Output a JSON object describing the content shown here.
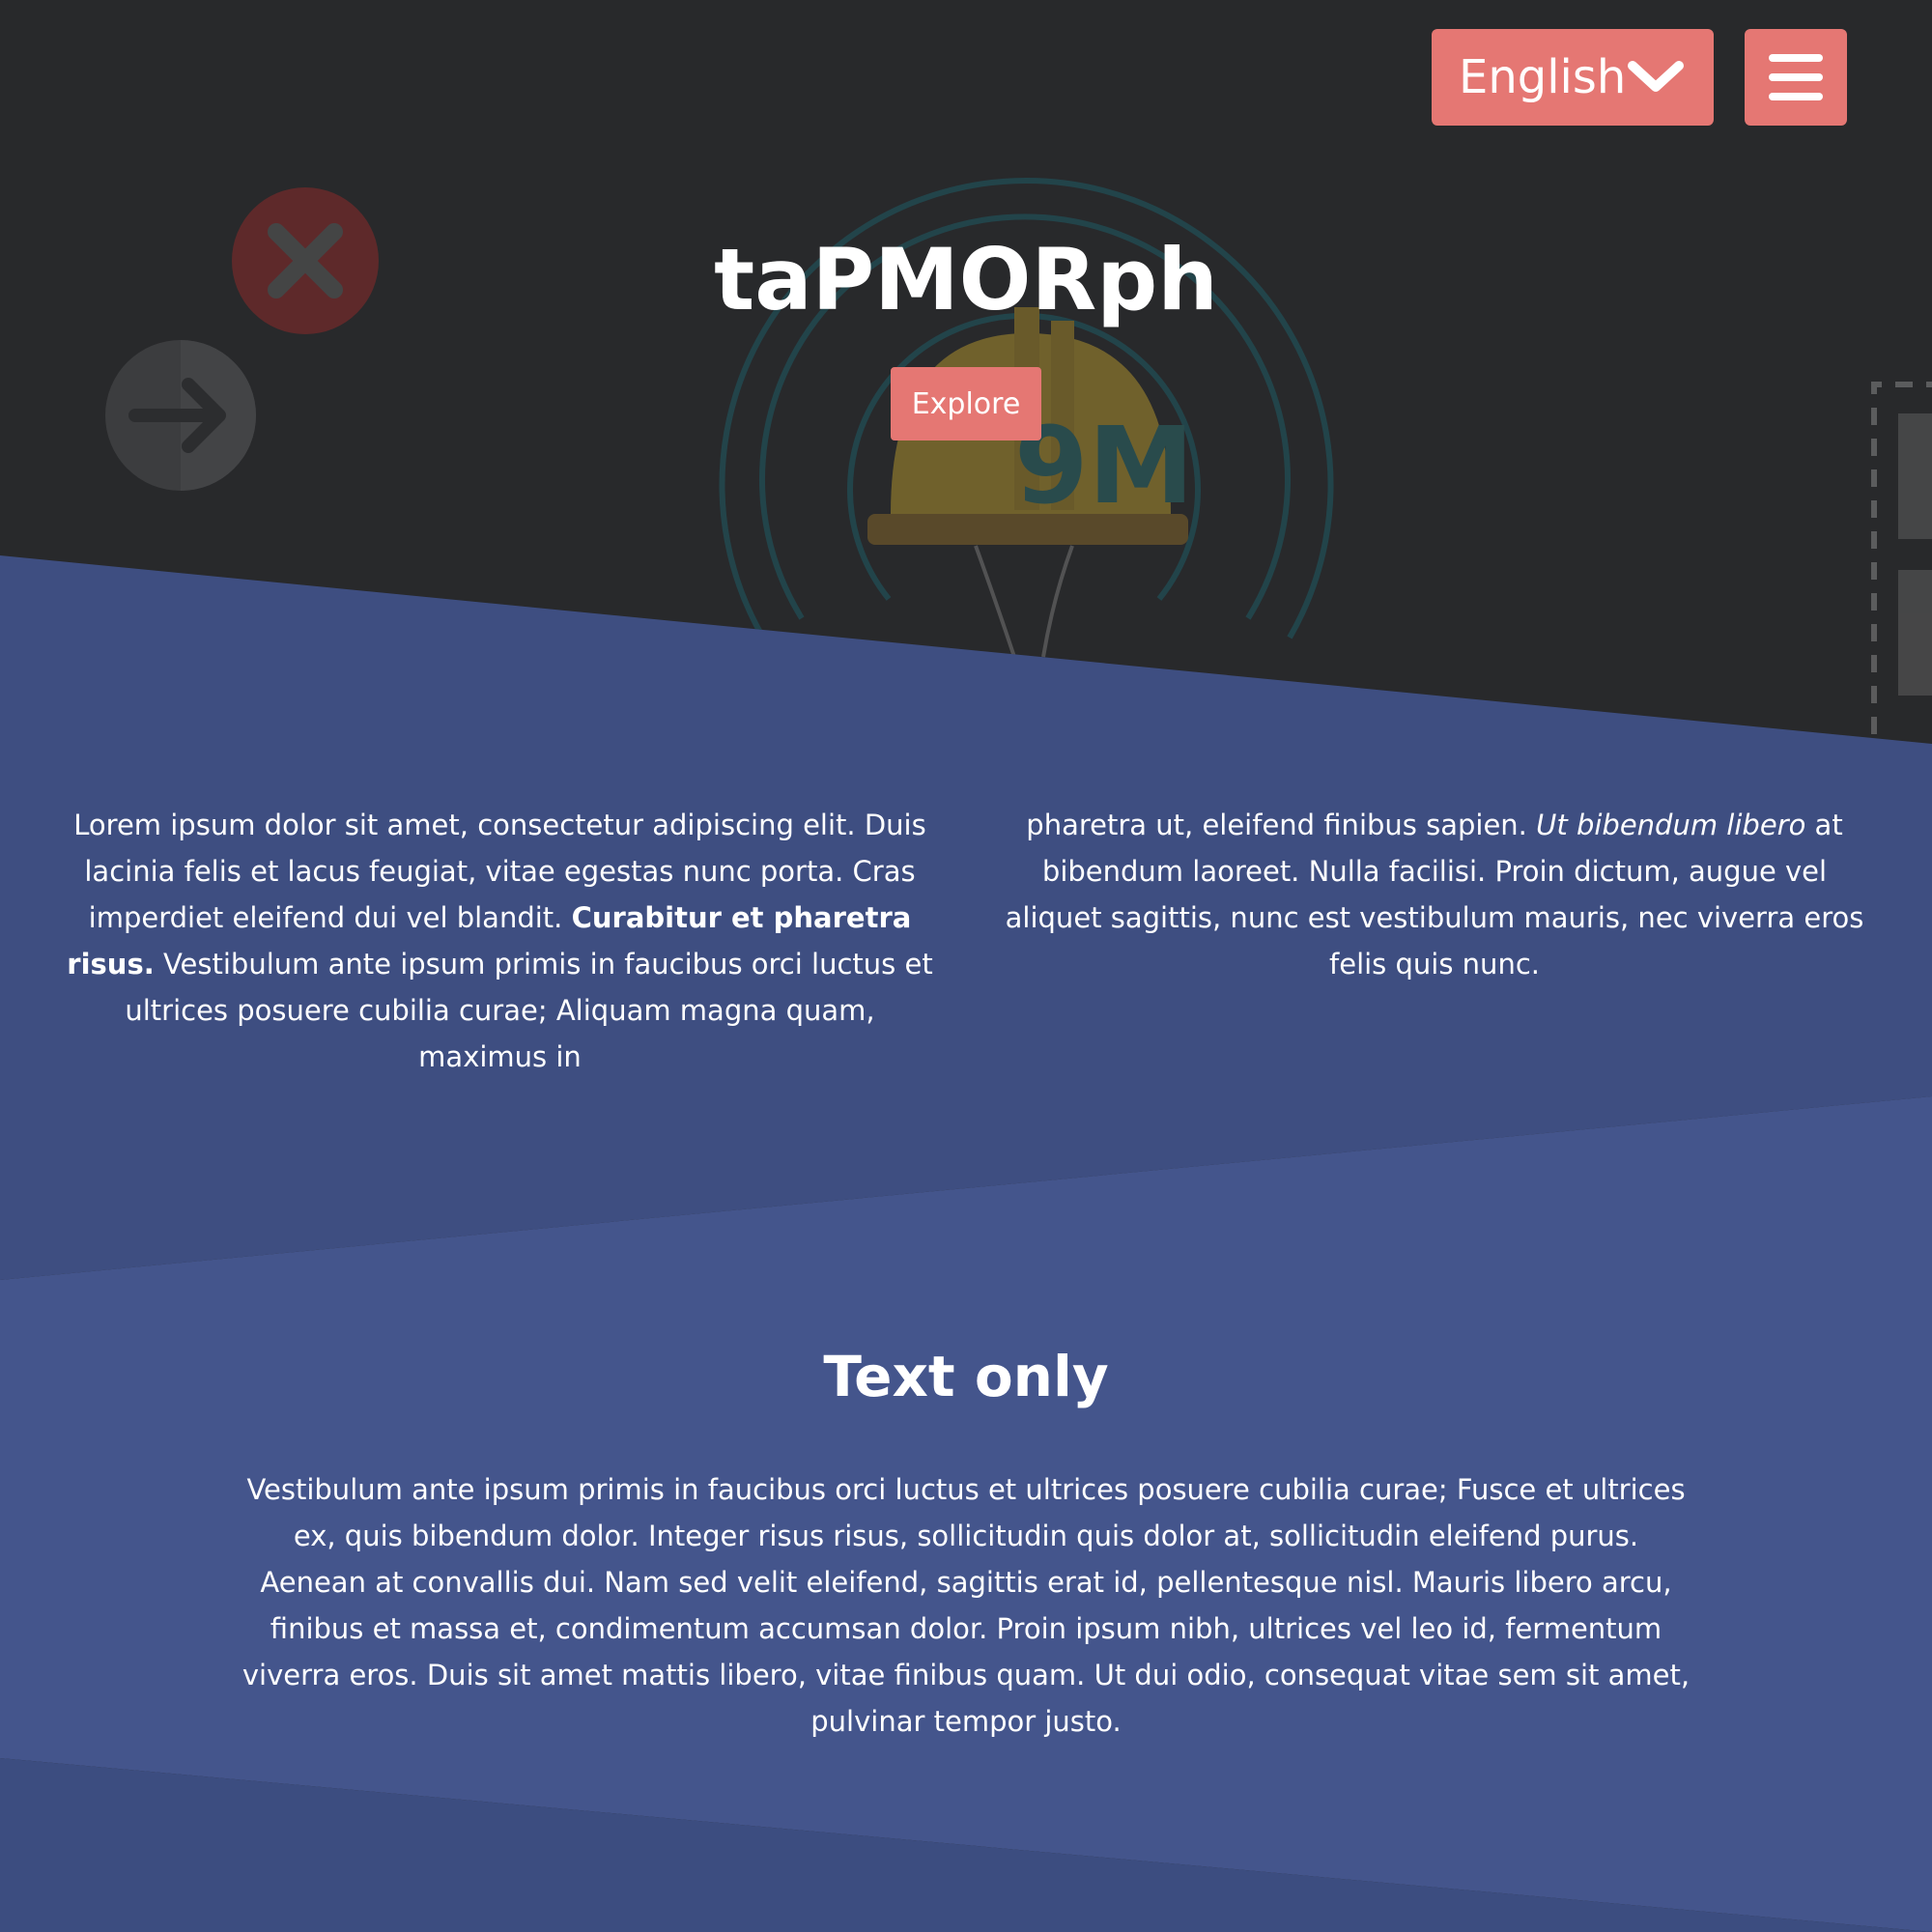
{
  "colors": {
    "accent": "#e57773",
    "hero_bg": "#28292b",
    "band_primary": "#3e4e81",
    "band_secondary": "#44558c",
    "text": "#ffffff"
  },
  "header": {
    "language_label": "English",
    "language_icon": "chevron-down-icon",
    "menu_icon": "hamburger-menu-icon"
  },
  "hero": {
    "title": "taPMORph",
    "explore_label": "Explore",
    "decor_icons": [
      "close-circle-icon",
      "arrow-right-circle-icon",
      "hard-hat-logo-icon"
    ]
  },
  "intro": {
    "left": {
      "before_bold": "Lorem ipsum dolor sit amet, consectetur adipiscing elit. Duis lacinia felis et lacus feugiat, vitae egestas nunc porta. Cras imperdiet eleifend dui vel blandit. ",
      "bold": "Curabitur et pharetra risus.",
      "after_bold": " Vestibulum ante ipsum primis in faucibus orci luctus et ultrices posuere cubilia curae; Aliquam magna quam, maximus in"
    },
    "right": {
      "before_italic": "pharetra ut, eleifend finibus sapien. ",
      "italic": "Ut bibendum libero",
      "after_italic": " at bibendum laoreet. Nulla facilisi. Proin dictum, augue vel aliquet sagittis, nunc est vestibulum mauris, nec viverra eros felis quis nunc."
    }
  },
  "text_only": {
    "title": "Text only",
    "body": "Vestibulum ante ipsum primis in faucibus orci luctus et ultrices posuere cubilia curae; Fusce et ultrices ex, quis bibendum dolor. Integer risus risus, sollicitudin quis dolor at, sollicitudin eleifend purus. Aenean at convallis dui. Nam sed velit eleifend, sagittis erat id, pellentesque nisl. Mauris libero arcu, finibus et massa et, condimentum accumsan dolor. Proin ipsum nibh, ultrices vel leo id, fermentum viverra eros. Duis sit amet mattis libero, vitae finibus quam. Ut dui odio, consequat vitae sem sit amet, pulvinar tempor justo."
  }
}
